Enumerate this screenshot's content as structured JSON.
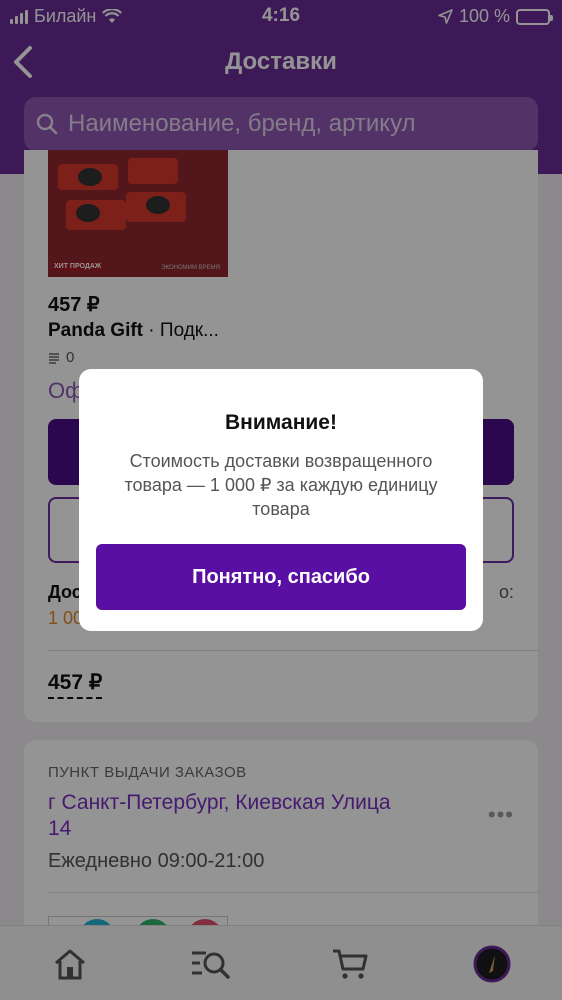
{
  "status_bar": {
    "carrier": "Билайн",
    "time": "4:16",
    "battery": "100 %"
  },
  "header": {
    "title": "Доставки",
    "back_icon": "chevron-left-icon"
  },
  "search": {
    "placeholder": "Наименование, бренд, артикул",
    "icon": "search-icon"
  },
  "product": {
    "image_tag": "ХИТ ПРОДАЖ",
    "image_caption": "ЭКОНОМИМ ВРЕМЯ",
    "price": "457 ₽",
    "brand": "Panda Gift",
    "separator": " · ",
    "name": "Подк...",
    "reviews_count": "0",
    "offer_link_partial": "Оф"
  },
  "delivery": {
    "label_partial": "Дос",
    "right_partial": "о:",
    "cost_partial": "1 00"
  },
  "total": "457 ₽",
  "pickup": {
    "label": "ПУНКТ ВЫДАЧИ ЗАКАЗОВ",
    "address": "г Санкт-Петербург, Киевская Улица 14",
    "more": "•••",
    "hours": "Ежедневно 09:00-21:00"
  },
  "bottom_nav": [
    "home-icon",
    "catalog-search-icon",
    "cart-icon",
    "profile-avatar-icon"
  ],
  "modal": {
    "title": "Внимание!",
    "text": "Стоимость доставки возвращенного товара — 1 000 ₽ за каждую единицу товара",
    "button": "Понятно, спасибо"
  },
  "colors": {
    "header_bg": "#6a2e96",
    "brand_purple": "#5a0fa4",
    "address_purple": "#7b2fc0",
    "cost_orange": "#e08a2a"
  }
}
